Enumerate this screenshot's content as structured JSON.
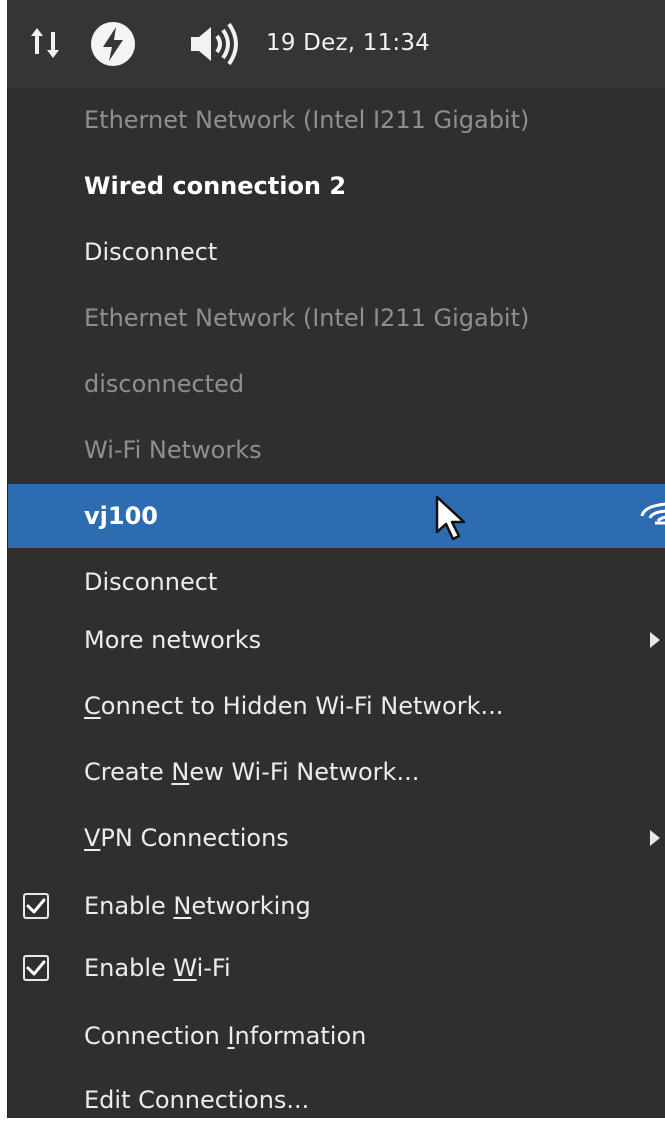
{
  "panel": {
    "clock": "19 Dez, 11:34",
    "icons": [
      "network-transfer-icon",
      "power-icon",
      "volume-icon"
    ]
  },
  "menu": {
    "items": [
      {
        "label": "Ethernet Network (Intel I211 Gigabit)",
        "style": "muted"
      },
      {
        "label": "Wired connection 2",
        "style": "bold"
      },
      {
        "label": "Disconnect",
        "style": "normal"
      },
      {
        "label": "Ethernet Network (Intel I211 Gigabit)",
        "style": "muted"
      },
      {
        "label": "disconnected",
        "style": "muted"
      },
      {
        "label": "Wi-Fi Networks",
        "style": "muted"
      },
      {
        "label": "vj100",
        "style": "selected",
        "icon": "wifi-signal-icon"
      },
      {
        "label": "Disconnect",
        "style": "normal"
      },
      {
        "label": "More networks",
        "style": "normal",
        "submenu": true
      },
      {
        "label_pre": "",
        "label_u": "C",
        "label_post": "onnect to Hidden Wi-Fi Network...",
        "style": "normal"
      },
      {
        "label_pre": "Create ",
        "label_u": "N",
        "label_post": "ew Wi-Fi Network...",
        "style": "normal"
      },
      {
        "label_pre": "",
        "label_u": "V",
        "label_post": "PN Connections",
        "style": "normal",
        "submenu": true
      },
      {
        "label_pre": "Enable ",
        "label_u": "N",
        "label_post": "etworking",
        "style": "normal",
        "checked": true
      },
      {
        "label_pre": "Enable ",
        "label_u": "W",
        "label_post": "i-Fi",
        "style": "normal",
        "checked": true
      },
      {
        "label_pre": "Connection ",
        "label_u": "I",
        "label_post": "nformation",
        "style": "normal"
      },
      {
        "label": "Edit Connections...",
        "style": "normal"
      }
    ]
  },
  "colors": {
    "panel_bg": "#353535",
    "menu_bg": "#2f2f2f",
    "highlight": "#2d6cb0",
    "muted_text": "#8f8f8f"
  }
}
